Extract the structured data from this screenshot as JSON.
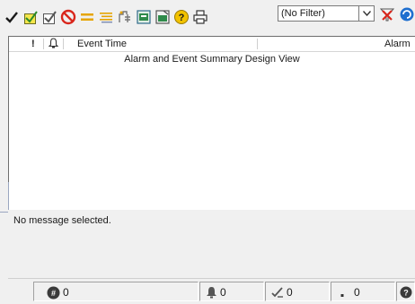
{
  "toolbar": {
    "buttons": [
      {
        "name": "acknowledge-checkmark-icon",
        "color": "#1a1a1a"
      },
      {
        "name": "acknowledge-all-icon",
        "color": "#d4c000"
      },
      {
        "name": "acknowledge-selected-icon",
        "color": "#4a4a4a"
      },
      {
        "name": "suppress-icon",
        "color": "#d9261c"
      },
      {
        "name": "equal-filter-icon",
        "color": "#e6a400"
      },
      {
        "name": "sort-lines-icon",
        "color": "#e6a400"
      },
      {
        "name": "freeze-icon",
        "color": "#777777"
      },
      {
        "name": "query-icon",
        "color": "#2f8a4a"
      },
      {
        "name": "properties-icon",
        "color": "#2f8a4a"
      },
      {
        "name": "help-icon",
        "color": "#e8b400"
      },
      {
        "name": "print-icon",
        "color": "#333333"
      }
    ],
    "filter": {
      "value": "(No Filter)"
    }
  },
  "grid": {
    "columns": [
      {
        "key": "priority",
        "label": "!"
      },
      {
        "key": "state",
        "label": ""
      },
      {
        "key": "time",
        "label": "Event Time"
      },
      {
        "key": "alarm",
        "label": "Alarm"
      }
    ],
    "caption": "Alarm and Event Summary Design View"
  },
  "message": {
    "text": "No message selected."
  },
  "statusbar": {
    "total_count": "0",
    "active_count": "0",
    "unack_count": "0",
    "suppressed_count": "0"
  },
  "colors": {
    "background": "#f0f0f0",
    "grid_background": "#ffffff",
    "accent_blue": "#1f6fcf"
  }
}
